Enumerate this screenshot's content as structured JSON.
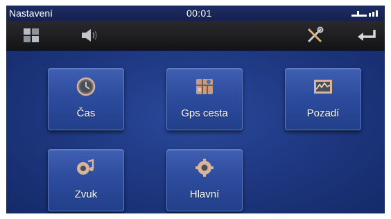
{
  "status": {
    "title": "Nastavení",
    "clock": "00:01"
  },
  "toolbar": {
    "menu_icon": "grid-icon",
    "volume_icon": "speaker-icon",
    "tools_icon": "tools-icon",
    "back_icon": "return-arrow-icon"
  },
  "tiles": [
    {
      "label": "Čas",
      "icon": "clock-icon"
    },
    {
      "label": "Gps cesta",
      "icon": "gps-map-icon"
    },
    {
      "label": "Pozadí",
      "icon": "wallpaper-icon"
    },
    {
      "label": "Zvuk",
      "icon": "sound-icon"
    },
    {
      "label": "Hlavní",
      "icon": "gear-icon"
    }
  ],
  "colors": {
    "accent": "#2d4c9e",
    "icon_tint": "#d9b49a",
    "background": "#0c1638"
  }
}
